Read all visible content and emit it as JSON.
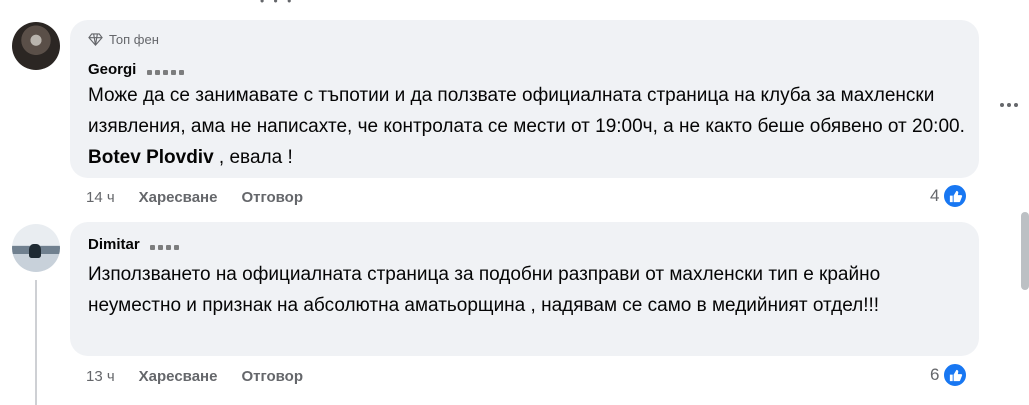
{
  "comments": [
    {
      "badge": "Топ фен",
      "author": "Georgi",
      "text_before_mention": "Може да се занимавате с тъпотии и да ползвате официалната страница на клуба за махленски изявления, ама не написахте, че контролата се мести от 19:00ч, а не както беше обявено от 20:00. ",
      "mention": "Botev Plovdiv",
      "text_after_mention": " , евала !",
      "time": "14 ч",
      "like_label": "Харесване",
      "reply_label": "Отговор",
      "reaction_count": "4"
    },
    {
      "author": "Dimitar",
      "text": "Използването на официалната страница за подобни разправи от махленски тип е крайно неуместно и признак на абсолютна аматьорщина , надявам се само в медийният отдел!!!",
      "time": "13 ч",
      "like_label": "Харесване",
      "reply_label": "Отговор",
      "reaction_count": "6"
    }
  ],
  "icons": {
    "badge": "diamond-icon",
    "reaction": "thumbs-up-icon",
    "menu": "more-options-icon"
  },
  "colors": {
    "bubble": "#f0f2f5",
    "meta_text": "#65676b",
    "like_blue": "#1877f2"
  }
}
